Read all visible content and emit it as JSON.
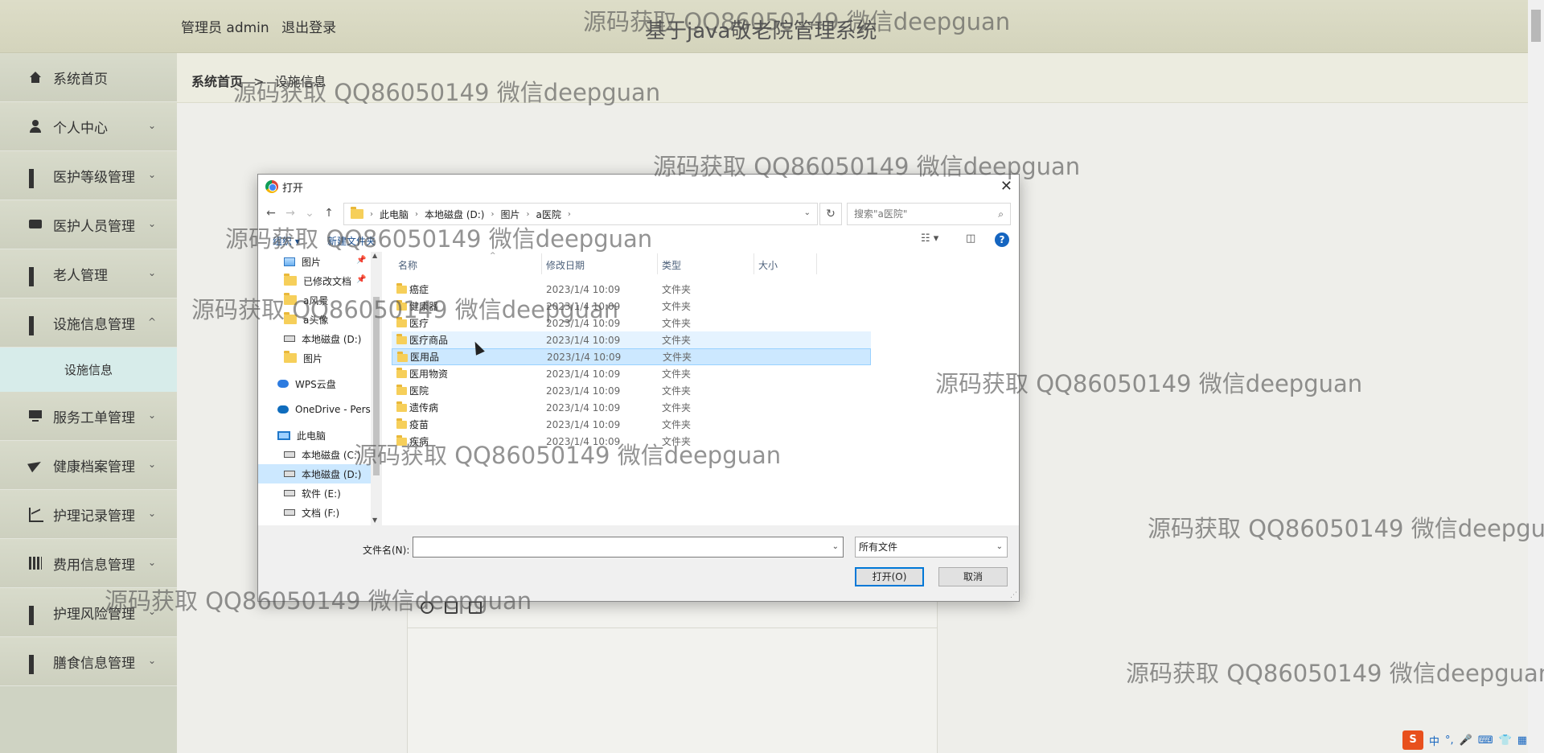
{
  "header": {
    "role_label": "管理员 admin",
    "logout_label": "退出登录",
    "site_title": "基于java敬老院管理系统"
  },
  "sidebar": {
    "items": [
      {
        "label": "系统首页",
        "icon": "home-icon"
      },
      {
        "label": "个人中心",
        "icon": "user-icon"
      },
      {
        "label": "医护等级管理",
        "icon": "grid-icon"
      },
      {
        "label": "医护人员管理",
        "icon": "chat-icon"
      },
      {
        "label": "老人管理",
        "icon": "grid-icon"
      },
      {
        "label": "设施信息管理",
        "icon": "grid-icon"
      },
      {
        "label": "服务工单管理",
        "icon": "monitor-icon"
      },
      {
        "label": "健康档案管理",
        "icon": "send-icon"
      },
      {
        "label": "护理记录管理",
        "icon": "chart-icon"
      },
      {
        "label": "费用信息管理",
        "icon": "bars-icon"
      },
      {
        "label": "护理风险管理",
        "icon": "grid-icon"
      },
      {
        "label": "膳食信息管理",
        "icon": "grid-icon"
      }
    ],
    "submenu": {
      "label": "设施信息"
    },
    "chevron_down": "⌄",
    "chevron_up": "^"
  },
  "breadcrumb": {
    "home": "系统首页",
    "sep": ">",
    "current": "设施信息"
  },
  "dialog": {
    "title": "打开",
    "close": "✕",
    "path": [
      "此电脑",
      "本地磁盘 (D:)",
      "图片",
      "a医院"
    ],
    "search_placeholder": "搜索\"a医院\"",
    "commands": {
      "organize": "组织 ▾",
      "new_folder": "新建文件夹"
    },
    "nav_items": [
      {
        "label": "图片",
        "icon": "pictures-icon",
        "pinned": true
      },
      {
        "label": "已修改文档",
        "icon": "folder-icon",
        "pinned": true
      },
      {
        "label": "a风景",
        "icon": "folder-icon"
      },
      {
        "label": "a头像",
        "icon": "folder-icon"
      },
      {
        "label": "本地磁盘 (D:)",
        "icon": "drive-icon"
      },
      {
        "label": "图片",
        "icon": "folder-icon"
      },
      {
        "label": "WPS云盘",
        "icon": "cloud-icon"
      },
      {
        "label": "OneDrive - Pers",
        "icon": "onedrive-icon"
      },
      {
        "label": "此电脑",
        "icon": "computer-icon"
      },
      {
        "label": "本地磁盘 (C:)",
        "icon": "drive-icon"
      },
      {
        "label": "本地磁盘 (D:)",
        "icon": "drive-icon",
        "selected": true
      },
      {
        "label": "软件 (E:)",
        "icon": "drive-icon"
      },
      {
        "label": "文档 (F:)",
        "icon": "drive-icon"
      }
    ],
    "columns": {
      "name": "名称",
      "date": "修改日期",
      "type": "类型",
      "size": "大小"
    },
    "files": [
      {
        "name": "癌症",
        "date": "2023/1/4 10:09",
        "type": "文件夹"
      },
      {
        "name": "健康器",
        "date": "2023/1/4 10:09",
        "type": "文件夹"
      },
      {
        "name": "医疗",
        "date": "2023/1/4 10:09",
        "type": "文件夹"
      },
      {
        "name": "医疗商品",
        "date": "2023/1/4 10:09",
        "type": "文件夹",
        "state": "hover"
      },
      {
        "name": "医用品",
        "date": "2023/1/4 10:09",
        "type": "文件夹",
        "state": "selected"
      },
      {
        "name": "医用物资",
        "date": "2023/1/4 10:09",
        "type": "文件夹"
      },
      {
        "name": "医院",
        "date": "2023/1/4 10:09",
        "type": "文件夹"
      },
      {
        "name": "遗传病",
        "date": "2023/1/4 10:09",
        "type": "文件夹"
      },
      {
        "name": "疫苗",
        "date": "2023/1/4 10:09",
        "type": "文件夹"
      },
      {
        "name": "疾病",
        "date": "2023/1/4 10:09",
        "type": "文件夹"
      }
    ],
    "filename_label": "文件名(N):",
    "filename_value": "",
    "filetype_value": "所有文件",
    "open_button": "打开(O)",
    "cancel_button": "取消"
  },
  "watermark_text": "源码获取 QQ86050149 微信deepguan",
  "ime": {
    "logo": "S",
    "lang": "中",
    "punct": "°,"
  },
  "colors": {
    "header_bg": "#d4d4bc",
    "sidebar_bg": "#cfd3c3",
    "submenu_bg": "#d7ecea",
    "selection": "#cce8ff",
    "primary_border": "#0078d7"
  }
}
